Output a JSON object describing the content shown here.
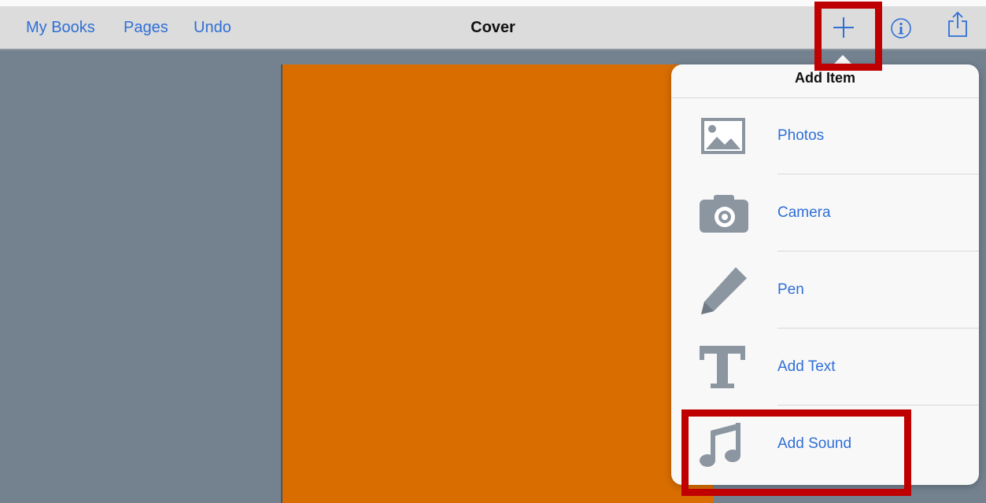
{
  "toolbar": {
    "my_books": "My Books",
    "pages": "Pages",
    "undo": "Undo",
    "title": "Cover",
    "add_icon": "plus-icon",
    "info_icon": "info-icon",
    "share_icon": "share-icon"
  },
  "popover": {
    "title": "Add Item",
    "items": [
      {
        "label": "Photos",
        "icon": "photos-icon"
      },
      {
        "label": "Camera",
        "icon": "camera-icon"
      },
      {
        "label": "Pen",
        "icon": "pen-icon"
      },
      {
        "label": "Add Text",
        "icon": "text-icon"
      },
      {
        "label": "Add Sound",
        "icon": "music-note-icon"
      }
    ]
  },
  "colors": {
    "accent": "#2f6fd6",
    "page": "#d96d00",
    "background": "#748290",
    "highlight": "#c00000"
  }
}
